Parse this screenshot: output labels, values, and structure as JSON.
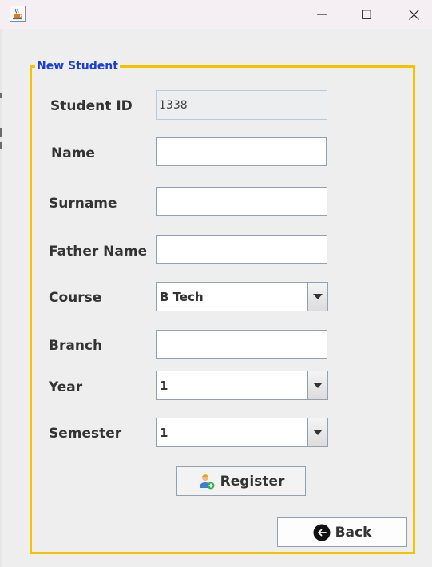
{
  "window": {
    "icon": "java-cup-icon",
    "controls": {
      "minimize": "minimize-icon",
      "maximize": "maximize-icon",
      "close": "close-icon"
    }
  },
  "form": {
    "group_title": "New Student",
    "fields": {
      "student_id": {
        "label": "Student ID",
        "value": "1338"
      },
      "name": {
        "label": "Name",
        "value": ""
      },
      "surname": {
        "label": "Surname",
        "value": ""
      },
      "father_name": {
        "label": "Father Name",
        "value": ""
      },
      "course": {
        "label": "Course",
        "selected": "B Tech"
      },
      "branch": {
        "label": "Branch",
        "value": ""
      },
      "year": {
        "label": "Year",
        "selected": "1"
      },
      "semester": {
        "label": "Semester",
        "selected": "1"
      }
    },
    "register_button": {
      "label": "Register",
      "icon": "add-user-icon"
    },
    "back_button": {
      "label": "Back",
      "icon": "back-arrow-icon"
    }
  },
  "colors": {
    "group_border": "#f5c200",
    "group_title": "#1a3fd6",
    "titlebar": "#f5eef3"
  }
}
